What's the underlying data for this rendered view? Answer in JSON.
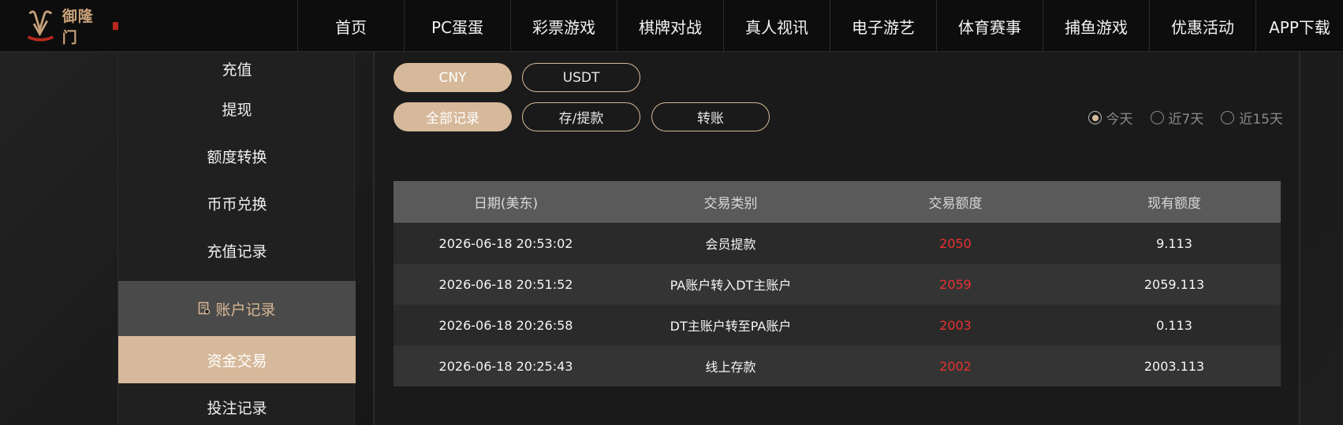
{
  "brand": {
    "logo_text": "御隆门",
    "accent_color": "#d6b99a"
  },
  "nav": [
    {
      "label": "首页"
    },
    {
      "label": "PC蛋蛋"
    },
    {
      "label": "彩票游戏"
    },
    {
      "label": "棋牌对战"
    },
    {
      "label": "真人视讯"
    },
    {
      "label": "电子游艺"
    },
    {
      "label": "体育赛事"
    },
    {
      "label": "捕鱼游戏"
    },
    {
      "label": "优惠活动"
    },
    {
      "label": "APP下载"
    }
  ],
  "sidebar": {
    "items": [
      {
        "label": "充值"
      },
      {
        "label": "提现"
      },
      {
        "label": "额度转换"
      },
      {
        "label": "币币兑换"
      },
      {
        "label": "充值记录"
      },
      {
        "label": "账户记录",
        "icon": "record-icon"
      },
      {
        "label": "资金交易"
      },
      {
        "label": "投注记录"
      }
    ]
  },
  "currency_tabs": [
    {
      "label": "CNY"
    },
    {
      "label": "USDT"
    }
  ],
  "record_tabs": [
    {
      "label": "全部记录"
    },
    {
      "label": "存/提款"
    },
    {
      "label": "转账"
    }
  ],
  "date_filter": [
    {
      "label": "今天"
    },
    {
      "label": "近7天"
    },
    {
      "label": "近15天"
    }
  ],
  "table": {
    "headers": [
      "日期(美东)",
      "交易类别",
      "交易额度",
      "现有额度"
    ],
    "rows": [
      {
        "date": "2026-06-18 20:53:02",
        "type": "会员提款",
        "amount": "2050",
        "balance": "9.113"
      },
      {
        "date": "2026-06-18 20:51:52",
        "type": "PA账户转入DT主账户",
        "amount": "2059",
        "balance": "2059.113"
      },
      {
        "date": "2026-06-18 20:26:58",
        "type": "DT主账户转至PA账户",
        "amount": "2003",
        "balance": "0.113"
      },
      {
        "date": "2026-06-18 20:25:43",
        "type": "线上存款",
        "amount": "2002",
        "balance": "2003.113"
      }
    ]
  }
}
